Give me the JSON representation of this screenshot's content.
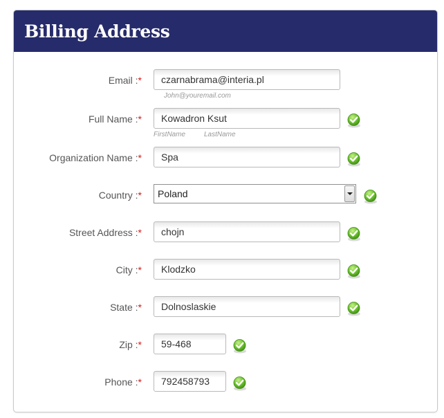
{
  "header": {
    "title": "Billing Address"
  },
  "form": {
    "colon": ":",
    "required_mark": "*",
    "email": {
      "label": "Email",
      "value": "czarnabrama@interia.pl",
      "hint": "John@youremail.com",
      "valid": false
    },
    "full_name": {
      "label": "Full Name",
      "value": "Kowadron Ksut",
      "hint_first": "FirstName",
      "hint_last": "LastName",
      "valid": true
    },
    "organization": {
      "label": "Organization Name",
      "value": "Spa",
      "valid": true
    },
    "country": {
      "label": "Country",
      "value": "Poland",
      "valid": true
    },
    "street": {
      "label": "Street Address",
      "value": "chojn",
      "valid": true
    },
    "city": {
      "label": "City",
      "value": "Klodzko",
      "valid": true
    },
    "state": {
      "label": "State",
      "value": "Dolnoslaskie",
      "valid": true
    },
    "zip": {
      "label": "Zip",
      "value": "59-468",
      "valid": true
    },
    "phone": {
      "label": "Phone",
      "value": "792458793",
      "valid": true
    }
  },
  "icons": {
    "valid": "checkmark-icon"
  },
  "colors": {
    "header_bg": "#262b6b",
    "required": "#d11a1a",
    "check_green": "#5fb82a"
  }
}
